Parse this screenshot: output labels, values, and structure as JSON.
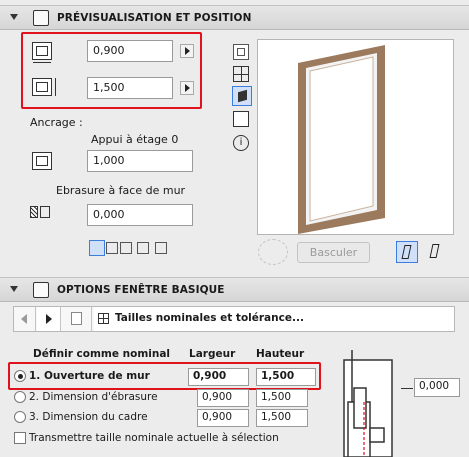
{
  "section1": {
    "title": "PRÉVISUALISATION ET POSITION"
  },
  "width_value": "0,900",
  "height_value": "1,500",
  "anchor_label": "Ancrage :",
  "anchor_floor_label": "Appui à étage 0",
  "anchor_floor_value": "1,000",
  "reveal_label": "Ebrasure à face de mur",
  "reveal_value": "0,000",
  "flip_button": "Basculer",
  "section2": {
    "title": "OPTIONS FENÊTRE BASIQUE"
  },
  "dropdown_value": "Tailles nominales et tolérance...",
  "nominal": {
    "header_label": "Définir comme nominal",
    "col_width": "Largeur",
    "col_height": "Hauteur",
    "rows": [
      {
        "label": "1. Ouverture de mur",
        "width": "0,900",
        "height": "1,500"
      },
      {
        "label": "2. Dimension d'ébrasure",
        "width": "0,900",
        "height": "1,500"
      },
      {
        "label": "3. Dimension du cadre",
        "width": "0,900",
        "height": "1,500"
      }
    ]
  },
  "transfer_label": "Transmettre taille nominale actuelle à sélection",
  "side_dim_value": "0,000",
  "colors": {
    "accent_red": "#e0121b",
    "selected_blue": "#3c7ee0",
    "frame_wood": "#9b7a5e"
  }
}
